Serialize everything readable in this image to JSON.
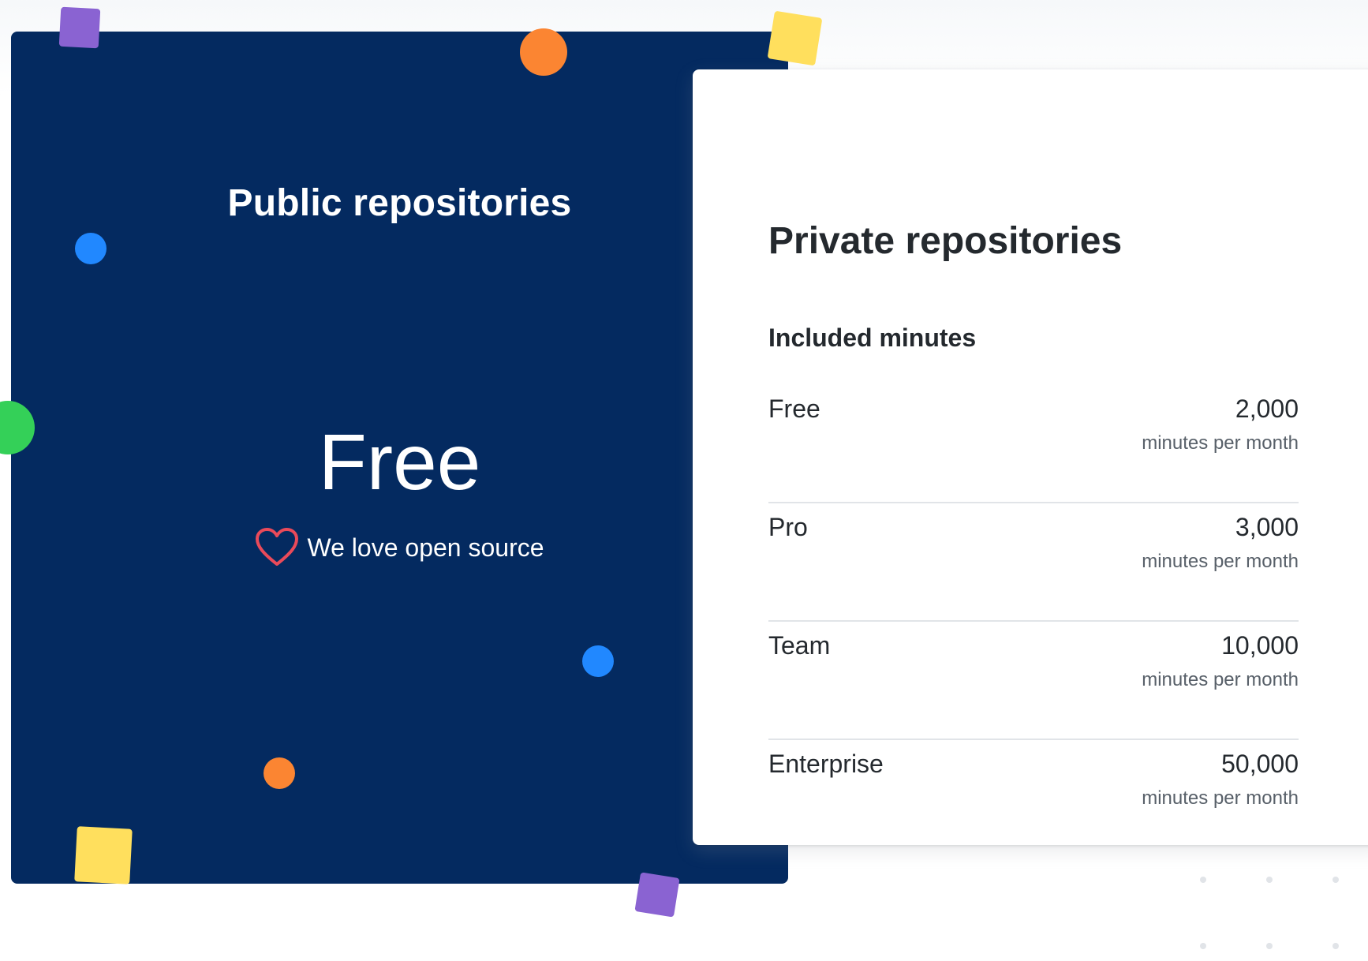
{
  "colors": {
    "public_card_bg": "#042a60",
    "heart": "#ea4a5a",
    "purple": "#8a63d2",
    "orange": "#fb8532",
    "yellow": "#ffdf5d",
    "blue": "#2188ff",
    "green": "#34d058"
  },
  "public": {
    "title": "Public repositories",
    "price": "Free",
    "tagline": "We love open source",
    "tagline_icon": "heart-icon"
  },
  "private": {
    "title": "Private repositories",
    "included_label": "Included minutes",
    "plans": [
      {
        "name": "Free",
        "minutes": "2,000",
        "unit": "minutes per month"
      },
      {
        "name": "Pro",
        "minutes": "3,000",
        "unit": "minutes per month"
      },
      {
        "name": "Team",
        "minutes": "10,000",
        "unit": "minutes per month"
      },
      {
        "name": "Enterprise",
        "minutes": "50,000",
        "unit": "minutes per month"
      }
    ]
  }
}
